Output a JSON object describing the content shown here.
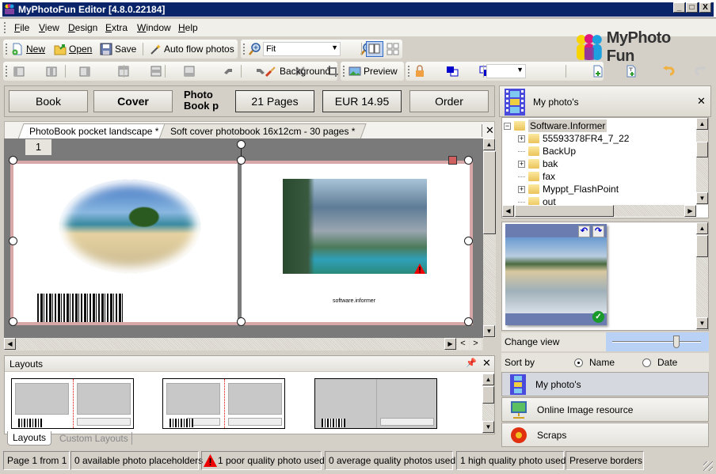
{
  "window": {
    "title": "MyPhotoFun Editor [4.8.0.22184]",
    "min": "_",
    "max": "□",
    "close": "X"
  },
  "menu": [
    {
      "label": "File",
      "u": "F",
      "rest": "ile"
    },
    {
      "label": "View",
      "u": "V",
      "rest": "iew"
    },
    {
      "label": "Design",
      "u": "D",
      "rest": "esign"
    },
    {
      "label": "Extra",
      "u": "E",
      "rest": "xtra"
    },
    {
      "label": "Window",
      "u": "W",
      "rest": "indow"
    },
    {
      "label": "Help",
      "u": "H",
      "rest": "elp"
    }
  ],
  "toolbar": {
    "new": "New",
    "open": "Open",
    "save": "Save",
    "auto_flow": "Auto flow photos",
    "zoom_value": "Fit",
    "background": "Background",
    "preview": "Preview",
    "size_value": ""
  },
  "logo": {
    "text": "MyPhoto Fun"
  },
  "nav": {
    "book": "Book",
    "cover": "Cover",
    "photo_book": "Photo\nBook p",
    "pages": "21 Pages",
    "price": "EUR 14.95",
    "order": "Order"
  },
  "doc_tabs": [
    {
      "label": "PhotoBook pocket landscape *",
      "active": true
    },
    {
      "label": "Soft cover photobook  16x12cm - 30 pages *",
      "active": false
    }
  ],
  "canvas": {
    "page_number": "1",
    "caption": "software.informer"
  },
  "layouts_panel": {
    "title": "Layouts",
    "tabs": [
      "Layouts",
      "Custom Layouts"
    ]
  },
  "right_panel": {
    "title": "My photo's",
    "tree": [
      {
        "label": "Software.Informer",
        "level": 0,
        "expander": "−",
        "selected": true
      },
      {
        "label": "55593378FR4_7_22",
        "level": 1,
        "expander": "+"
      },
      {
        "label": "BackUp",
        "level": 1,
        "expander": ""
      },
      {
        "label": "bak",
        "level": 1,
        "expander": "+"
      },
      {
        "label": "fax",
        "level": 1,
        "expander": ""
      },
      {
        "label": "Myppt_FlashPoint",
        "level": 1,
        "expander": "+"
      },
      {
        "label": "out",
        "level": 1,
        "expander": ""
      }
    ],
    "change_view": "Change view",
    "change_view_slider": 0.72,
    "sort_by": "Sort by",
    "sort_options": [
      {
        "label": "Name",
        "checked": true
      },
      {
        "label": "Date",
        "checked": false
      }
    ],
    "sections": [
      {
        "label": "My photo's",
        "icon": "filmstrip-icon",
        "active": true
      },
      {
        "label": "Online Image resource",
        "icon": "monitor-globe-icon",
        "active": false
      },
      {
        "label": "Scraps",
        "icon": "flower-icon",
        "active": false
      }
    ]
  },
  "status": [
    "Page 1 from 1",
    "0 available photo placeholders",
    "1 poor quality photo used",
    "0 average quality photos used",
    "1 high quality photo used",
    "Preserve borders"
  ]
}
